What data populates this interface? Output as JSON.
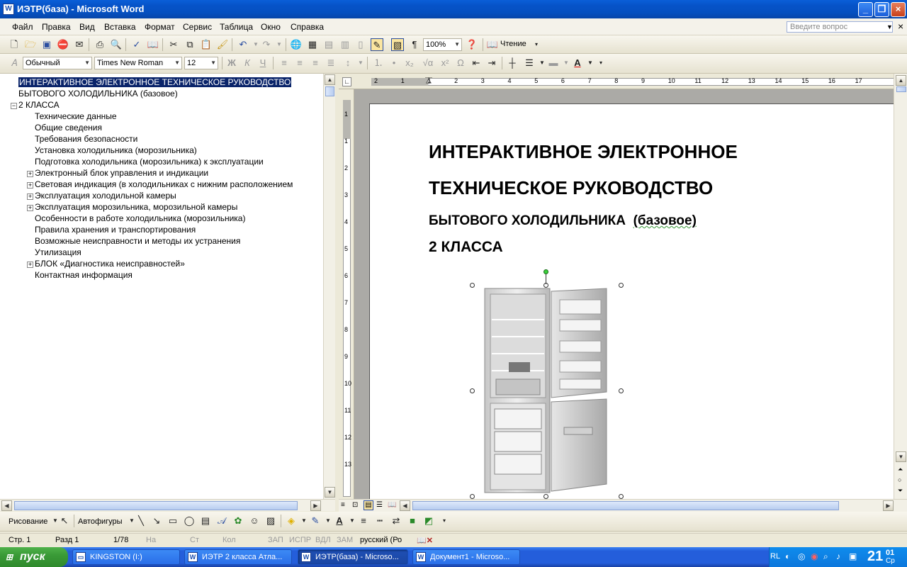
{
  "window": {
    "title": "ИЭТР(база) - Microsoft Word",
    "app_icon": "W"
  },
  "menu": {
    "items": [
      "Файл",
      "Правка",
      "Вид",
      "Вставка",
      "Формат",
      "Сервис",
      "Таблица",
      "Окно",
      "Справка"
    ],
    "question_placeholder": "Введите вопрос"
  },
  "toolbar": {
    "zoom": "100%",
    "reading_label": "Чтение"
  },
  "formatting": {
    "style": "Обычный",
    "font": "Times New Roman",
    "size": "12"
  },
  "outline": {
    "items": [
      {
        "text": "ИНТЕРАКТИВНОЕ ЭЛЕКТРОННОЕ ТЕХНИЧЕСКОЕ РУКОВОДСТВО",
        "expander": ""
      },
      {
        "text": "БЫТОВОГО ХОЛОДИЛЬНИКА  (базовое)",
        "expander": ""
      },
      {
        "text": "2 КЛАССА",
        "expander": "−"
      },
      {
        "text": "Технические данные",
        "expander": ""
      },
      {
        "text": "Общие сведения",
        "expander": ""
      },
      {
        "text": "Требования безопасности",
        "expander": ""
      },
      {
        "text": "Установка холодильника (морозильника)",
        "expander": ""
      },
      {
        "text": "Подготовка холодильника (морозильника) к эксплуатации",
        "expander": ""
      },
      {
        "text": "Электронный блок управления и индикации",
        "expander": "+"
      },
      {
        "text": "Световая индикация (в холодильниках  с  нижним расположением",
        "expander": "+"
      },
      {
        "text": "Эксплуатация холодильной камеры",
        "expander": "+"
      },
      {
        "text": "Эксплуатация морозильника, морозильной камеры",
        "expander": "+"
      },
      {
        "text": "Особенности в работе холодильника (морозильника)",
        "expander": ""
      },
      {
        "text": "Правила хранения и транспортирования",
        "expander": ""
      },
      {
        "text": "Возможные неисправности и методы их устранения",
        "expander": ""
      },
      {
        "text": "Утилизация",
        "expander": ""
      },
      {
        "text": "БЛОК «Диагностика неисправностей»",
        "expander": "+"
      },
      {
        "text": "Контактная информация",
        "expander": ""
      }
    ]
  },
  "ruler": {
    "marks": [
      "2",
      "1",
      "1",
      "2",
      "3",
      "4",
      "5",
      "6",
      "7",
      "8",
      "9",
      "10",
      "11",
      "12",
      "13",
      "14",
      "15",
      "16",
      "17"
    ],
    "v_marks": [
      "1",
      "1",
      "2",
      "3",
      "4",
      "5",
      "6",
      "7",
      "8",
      "9",
      "10",
      "11",
      "12",
      "13"
    ]
  },
  "document": {
    "line1": "ИНТЕРАКТИВНОЕ ЭЛЕКТРОННОЕ",
    "line2": "ТЕХНИЧЕСКОЕ РУКОВОДСТВО",
    "line3a": "БЫТОВОГО ХОЛОДИЛЬНИКА",
    "line3b": "(базовое)",
    "line4": "2 КЛАССА"
  },
  "drawing": {
    "draw_label": "Рисование",
    "autoshapes_label": "Автофигуры"
  },
  "status": {
    "page": "Стр.  1",
    "section": "Разд  1",
    "pages": "1/78",
    "at": "На",
    "line": "Ст",
    "col": "Кол",
    "rec": "ЗАП",
    "trk": "ИСПР",
    "ext": "ВДЛ",
    "ovr": "ЗАМ",
    "lang": "русский (Ро"
  },
  "taskbar": {
    "start": "пуск",
    "tasks": [
      {
        "label": "KINGSTON (I:)"
      },
      {
        "label": "ИЭТР 2 класса Атла..."
      },
      {
        "label": "ИЭТР(база) - Microso..."
      },
      {
        "label": "Документ1 - Microso..."
      }
    ],
    "lang": "RL",
    "clock_h": "21",
    "clock_m": "01",
    "clock_day": "Ср"
  }
}
